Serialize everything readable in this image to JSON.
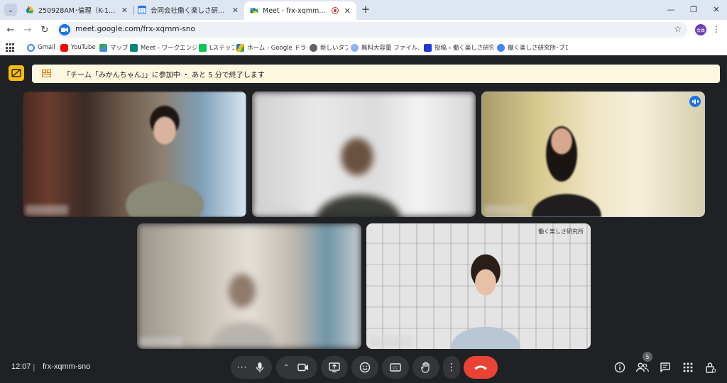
{
  "browser": {
    "tabs": [
      {
        "title": "250928AM･倫理（K-1） - Goo",
        "favicon": "drive-icon",
        "active": false
      },
      {
        "title": "合同会社働く楽しさ研究所 - カレ",
        "favicon": "calendar-icon",
        "active": false
      },
      {
        "title": "Meet - frx-xqmm-sno",
        "favicon": "meet-icon",
        "active": true,
        "recording": true
      }
    ],
    "new_tab_label": "+",
    "url": "meet.google.com/frx-xqmm-sno",
    "profile_initials": "会員",
    "bookmarks": [
      {
        "label": "Gmail",
        "icon": "google-icon",
        "color": "#4285f4"
      },
      {
        "label": "YouTube",
        "icon": "youtube-icon",
        "color": "#ff0000"
      },
      {
        "label": "マップ",
        "icon": "maps-icon",
        "color": "#34a853"
      },
      {
        "label": "Meet - ワークエンジョイ",
        "icon": "meet-icon",
        "color": "#00897b"
      },
      {
        "label": "Lステップ",
        "icon": "lstep-icon",
        "color": "#06c755"
      },
      {
        "label": "ホーム - Google ドライブ",
        "icon": "drive-icon",
        "color": "#fbbc04"
      },
      {
        "label": "新しいタブ",
        "icon": "globe-icon",
        "color": "#5f6368"
      },
      {
        "label": "無料大容量 ファイル…",
        "icon": "globe-icon",
        "color": "#8ab4f8"
      },
      {
        "label": "投稿 ‹ 働く楽しさ研究…",
        "icon": "wordpress-icon",
        "color": "#1e3ad6"
      },
      {
        "label": "働く楽しさ研究所･ブロ…",
        "icon": "chrome-icon",
        "color": "#4285f4"
      }
    ]
  },
  "meet": {
    "notice": "「チーム「みかんちゃん」」に参加中 ・ あと 5 分で終了します",
    "time": "12:07",
    "separator": "|",
    "meeting_code": "frx-xqmm-sno",
    "participant_count": "5",
    "tile_caption": "働く楽しさ研究所"
  },
  "colors": {
    "background": "#202124",
    "notice_bg": "#fef7e0",
    "notice_icon": "#fbbc04",
    "end_call": "#ea4335",
    "control_bg": "#333537",
    "speaker_ring": "#a8c7fa"
  }
}
